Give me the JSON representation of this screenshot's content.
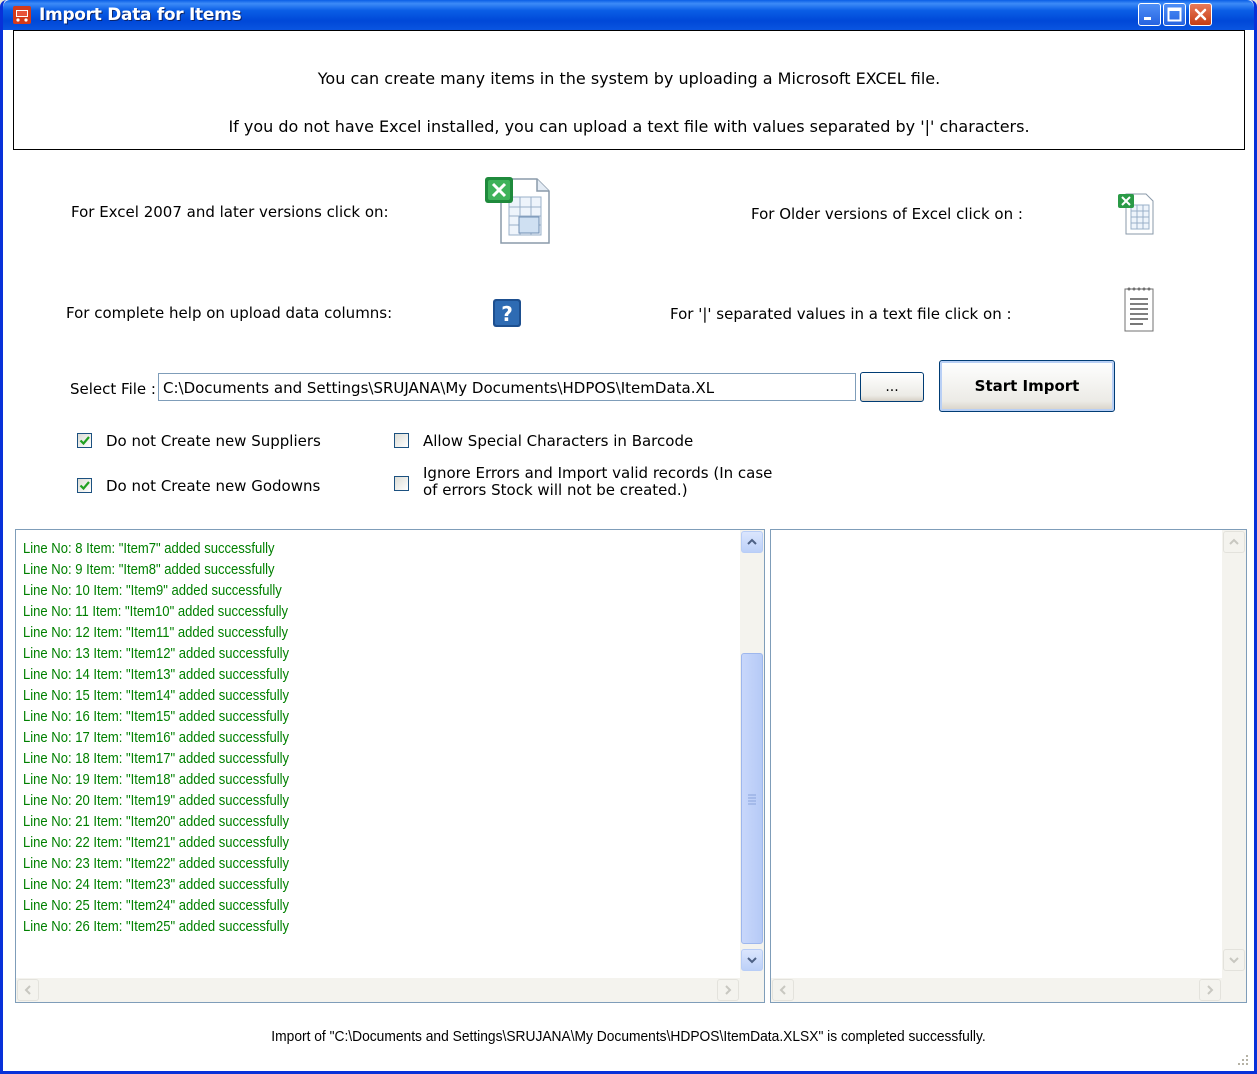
{
  "window": {
    "title": "Import Data for Items",
    "colors": {
      "titlebar": "#0a5ee6",
      "log_text": "#008000",
      "close": "#c53d14"
    }
  },
  "header": {
    "line1": "You can create many items in the system by uploading a Microsoft EXCEL file.",
    "line2": "If you do not have Excel installed, you can upload a text file with values separated by '|' characters."
  },
  "templates": {
    "excel2007_label": "For Excel 2007 and later versions click on:",
    "excel2007_icon": "excel-xlsx-icon",
    "excel_old_label": "For Older versions of Excel click on :",
    "excel_old_icon": "excel-xls-icon",
    "help_label": "For complete help on upload data columns:",
    "help_icon": "help-icon",
    "text_label": "For '|' separated  values in a text file click on :",
    "text_icon": "notepad-icon"
  },
  "file": {
    "label": "Select File :",
    "path": "C:\\Documents and Settings\\SRUJANA\\My Documents\\HDPOS\\ItemData.XL",
    "browse_label": "...",
    "start_label": "Start Import"
  },
  "options": {
    "no_suppliers": {
      "label": "Do not Create new Suppliers",
      "checked": true
    },
    "no_godowns": {
      "label": "Do not Create new Godowns",
      "checked": true
    },
    "special_chars": {
      "label": "Allow Special Characters in Barcode",
      "checked": false
    },
    "ignore_errors": {
      "label_line1": "Ignore Errors and Import valid records (In case",
      "label_line2": "of errors Stock will not be created.)",
      "checked": false
    }
  },
  "log": {
    "lines": [
      "Line No: 8 Item: \"Item7\" added successfully",
      "Line No: 9 Item: \"Item8\" added successfully",
      "Line No: 10 Item: \"Item9\" added successfully",
      "Line No: 11 Item: \"Item10\" added successfully",
      "Line No: 12 Item: \"Item11\" added successfully",
      "Line No: 13 Item: \"Item12\" added successfully",
      "Line No: 14 Item: \"Item13\" added successfully",
      "Line No: 15 Item: \"Item14\" added successfully",
      "Line No: 16 Item: \"Item15\" added successfully",
      "Line No: 17 Item: \"Item16\" added successfully",
      "Line No: 18 Item: \"Item17\" added successfully",
      "Line No: 19 Item: \"Item18\" added successfully",
      "Line No: 20 Item: \"Item19\" added successfully",
      "Line No: 21 Item: \"Item20\" added successfully",
      "Line No: 22 Item: \"Item21\" added successfully",
      "Line No: 23 Item: \"Item22\" added successfully",
      "Line No: 24 Item: \"Item23\" added successfully",
      "Line No: 25 Item: \"Item24\" added successfully",
      "Line No: 26 Item: \"Item25\" added successfully"
    ]
  },
  "errors": {
    "lines": []
  },
  "status": {
    "message": "Import of \"C:\\Documents and Settings\\SRUJANA\\My Documents\\HDPOS\\ItemData.XLSX\" is completed successfully."
  }
}
